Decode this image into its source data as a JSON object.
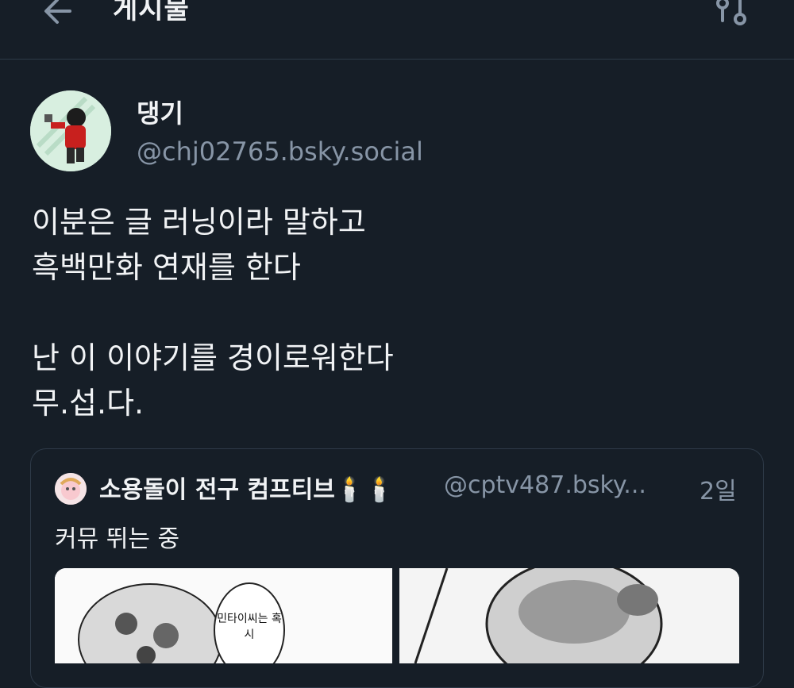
{
  "header": {
    "title": "게시물",
    "back_icon": "arrow-left-icon",
    "thread_icon": "thread-view-icon"
  },
  "post": {
    "author": {
      "display_name": "댕기",
      "handle": "@chj02765.bsky.social"
    },
    "text_lines": [
      "이분은 글 러닝이라 말하고",
      "흑백만화 연재를 한다",
      "",
      "난 이 이야기를 경이로워한다",
      "무.섭.다."
    ]
  },
  "quote": {
    "author": {
      "display_name": "소용돌이 전구 컴프티브🕯️🕯️",
      "handle": "@cptv487.bsky...",
      "time": "2일"
    },
    "text": "커뮤 뛰는 중",
    "images": [
      {
        "bubble_text": "민타이씨는 혹시"
      },
      {
        "bubble_text": ""
      }
    ]
  },
  "colors": {
    "background": "#161e27",
    "border": "#2e3a48",
    "muted_text": "#8795a6",
    "text": "#f1f3f5"
  }
}
